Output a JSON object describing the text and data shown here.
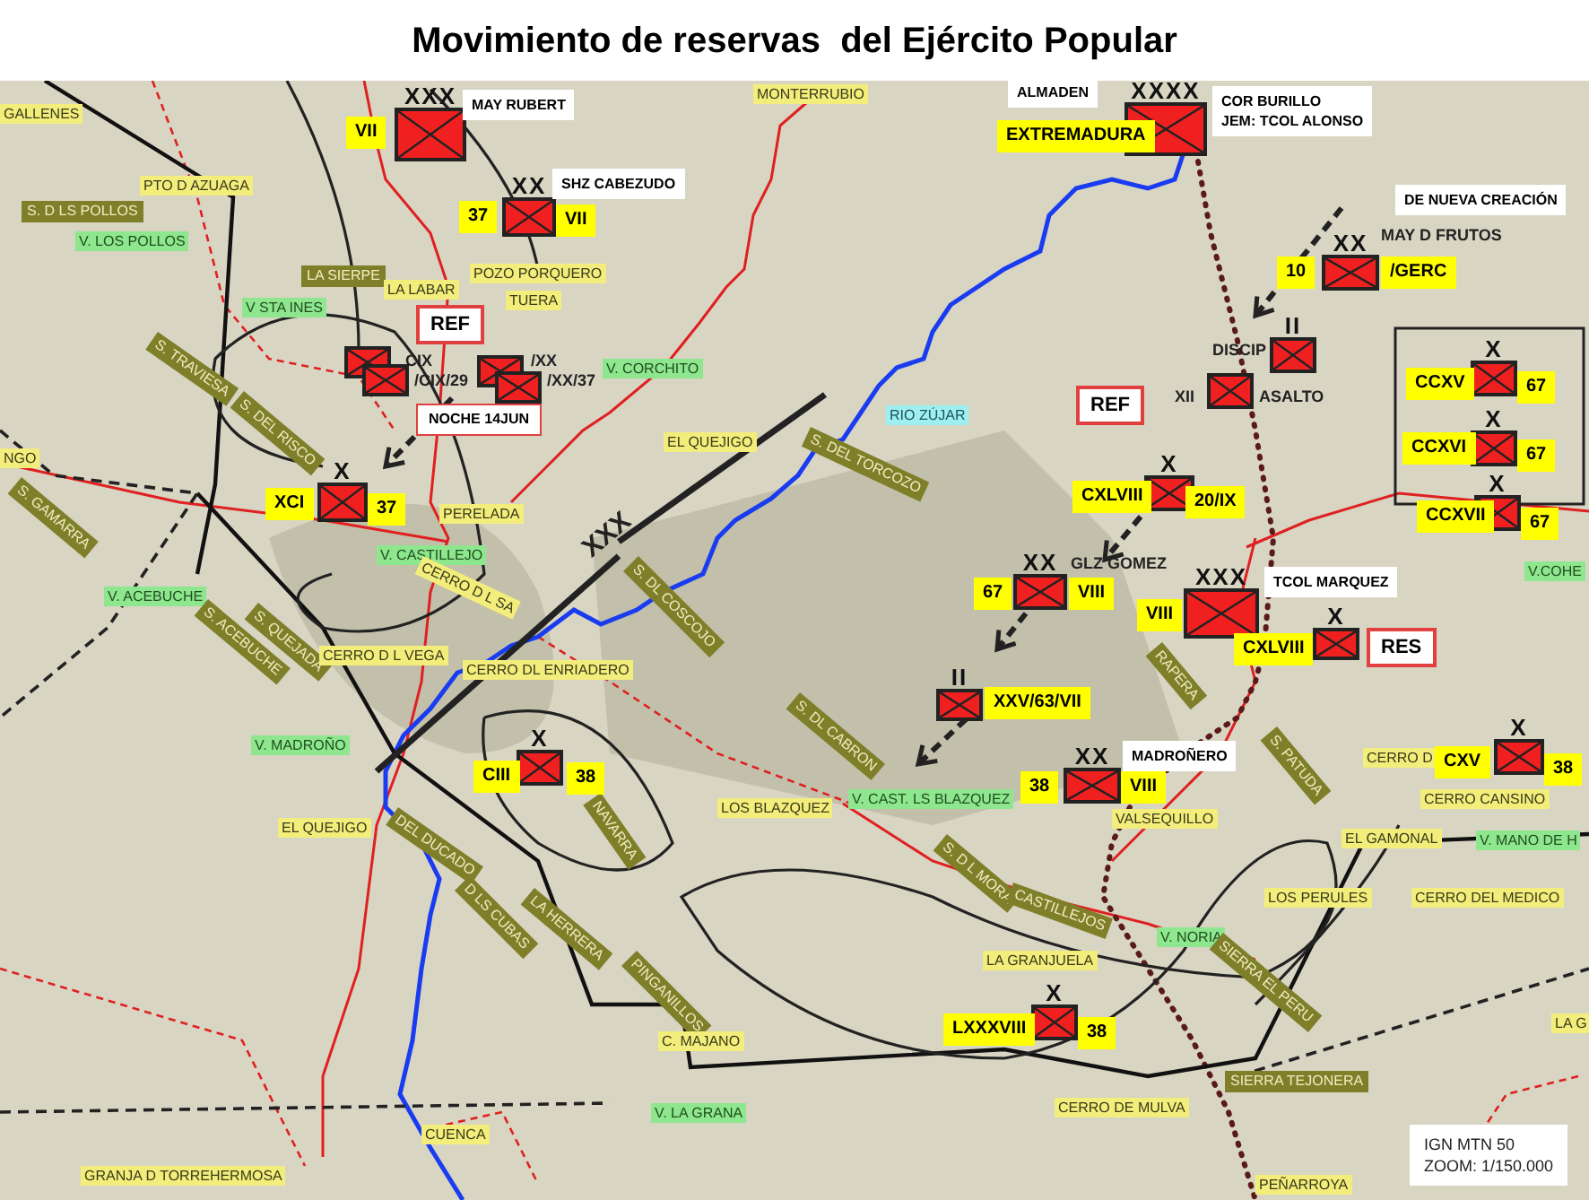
{
  "title": "Movimiento de reservas  del Ejército Popular",
  "units": [
    {
      "kind": "infantry",
      "echelon": "XXX"
    },
    {
      "kind": "infantry",
      "echelon": "XX"
    },
    {
      "kind": "infantry"
    },
    {
      "kind": "infantry"
    },
    {
      "kind": "infantry"
    },
    {
      "kind": "infantry"
    },
    {
      "kind": "infantry",
      "echelon": "X"
    },
    {
      "kind": "infantry",
      "echelon": "XXXX"
    },
    {
      "kind": "infantry",
      "echelon": "XX"
    },
    {
      "kind": "infantry",
      "echelon": "II"
    },
    {
      "kind": "infantry"
    },
    {
      "kind": "infantry",
      "echelon": "X"
    },
    {
      "kind": "infantry",
      "echelon": "X"
    },
    {
      "kind": "infantry",
      "echelon": "X"
    },
    {
      "kind": "infantry",
      "echelon": "X"
    },
    {
      "kind": "infantry",
      "echelon": "XX"
    },
    {
      "kind": "infantry",
      "echelon": "XXX"
    },
    {
      "kind": "infantry",
      "echelon": "X"
    },
    {
      "kind": "infantry",
      "echelon": "II"
    },
    {
      "kind": "infantry",
      "echelon": "XX"
    },
    {
      "kind": "infantry",
      "echelon": "X"
    },
    {
      "kind": "infantry",
      "echelon": "X"
    },
    {
      "kind": "infantry",
      "echelon": "X"
    }
  ],
  "callouts": [
    {
      "text": "MAY RUBERT",
      "kind": "note"
    },
    {
      "text": "VII",
      "kind": "tag"
    },
    {
      "text": "SHZ CABEZUDO",
      "kind": "note"
    },
    {
      "text": "37",
      "kind": "tag"
    },
    {
      "text": "VII",
      "kind": "tag"
    },
    {
      "text": "REF",
      "kind": "marker"
    },
    {
      "text": "CIX",
      "kind": "plain"
    },
    {
      "text": "/CIX/29",
      "kind": "plain"
    },
    {
      "text": "/XX",
      "kind": "plain"
    },
    {
      "text": "/XX/37",
      "kind": "plain"
    },
    {
      "text": "NOCHE 14JUN",
      "kind": "alert"
    },
    {
      "text": "XCI",
      "kind": "tag"
    },
    {
      "text": "37",
      "kind": "tag"
    },
    {
      "text": "XXX",
      "kind": "boundary"
    },
    {
      "text": "ALMADEN",
      "kind": "note"
    },
    {
      "text": "EXTREMADURA",
      "kind": "tag"
    },
    {
      "text": "COR BURILLO\nJEM: TCOL ALONSO",
      "kind": "note"
    },
    {
      "text": "DE NUEVA CREACIÓN",
      "kind": "note"
    },
    {
      "text": "MAY D FRUTOS",
      "kind": "plain"
    },
    {
      "text": "10",
      "kind": "tag"
    },
    {
      "text": "/GERC",
      "kind": "tag"
    },
    {
      "text": "DISCIP",
      "kind": "plain"
    },
    {
      "text": "XII",
      "kind": "plain"
    },
    {
      "text": "ASALTO",
      "kind": "plain"
    },
    {
      "text": "REF",
      "kind": "marker"
    },
    {
      "text": "CXLVIII",
      "kind": "tag"
    },
    {
      "text": "20/IX",
      "kind": "tag"
    },
    {
      "text": "CCXV",
      "kind": "tag"
    },
    {
      "text": "67",
      "kind": "tag"
    },
    {
      "text": "CCXVI",
      "kind": "tag"
    },
    {
      "text": "67",
      "kind": "tag"
    },
    {
      "text": "CCXVII",
      "kind": "tag"
    },
    {
      "text": "67",
      "kind": "tag"
    },
    {
      "text": "GLZ GOMEZ",
      "kind": "plain"
    },
    {
      "text": "67",
      "kind": "tag"
    },
    {
      "text": "VIII",
      "kind": "tag"
    },
    {
      "text": "TCOL MARQUEZ",
      "kind": "note"
    },
    {
      "text": "VIII",
      "kind": "tag"
    },
    {
      "text": "CXLVIII",
      "kind": "tag"
    },
    {
      "text": "RES",
      "kind": "marker"
    },
    {
      "text": "XXV/63/VII",
      "kind": "tag"
    },
    {
      "text": "MADROÑERO",
      "kind": "note"
    },
    {
      "text": "38",
      "kind": "tag"
    },
    {
      "text": "VIII",
      "kind": "tag"
    },
    {
      "text": "CIII",
      "kind": "tag"
    },
    {
      "text": "38",
      "kind": "tag"
    },
    {
      "text": "CXV",
      "kind": "tag"
    },
    {
      "text": "38",
      "kind": "tag"
    },
    {
      "text": "LXXXVIII",
      "kind": "tag"
    },
    {
      "text": "38",
      "kind": "tag"
    },
    {
      "text": "IGN MTN 50\nZOOM: 1/150.000",
      "kind": "source"
    }
  ],
  "place_labels": [
    {
      "text": "GALLENES",
      "kind": "town"
    },
    {
      "text": "PTO D AZUAGA",
      "kind": "town"
    },
    {
      "text": "S. D LS POLLOS",
      "kind": "range"
    },
    {
      "text": "V. LOS POLLOS",
      "kind": "vertex"
    },
    {
      "text": "LA SIERPE",
      "kind": "range"
    },
    {
      "text": "LA LABAR",
      "kind": "town"
    },
    {
      "text": "POZO PORQUERO",
      "kind": "town"
    },
    {
      "text": "TUERA",
      "kind": "town"
    },
    {
      "text": "V STA INES",
      "kind": "vertex"
    },
    {
      "text": "S. TRAVIESA",
      "kind": "range"
    },
    {
      "text": "S. DEL RISCO",
      "kind": "range"
    },
    {
      "text": "NGO",
      "kind": "town"
    },
    {
      "text": "S. GAMARRA",
      "kind": "range"
    },
    {
      "text": "V. CORCHITO",
      "kind": "vertex"
    },
    {
      "text": "EL QUEJIGO",
      "kind": "town"
    },
    {
      "text": "MONTERRUBIO",
      "kind": "town"
    },
    {
      "text": "RIO ZÚJAR",
      "kind": "river"
    },
    {
      "text": "S. DEL TORCOZO",
      "kind": "range"
    },
    {
      "text": "PERELADA",
      "kind": "town"
    },
    {
      "text": "V. CASTILLEJO",
      "kind": "vertex"
    },
    {
      "text": "CERRO D L SA",
      "kind": "town"
    },
    {
      "text": "V. ACEBUCHE",
      "kind": "vertex"
    },
    {
      "text": "S. ACEBUCHE",
      "kind": "range"
    },
    {
      "text": "S. DL COSCOJO",
      "kind": "range"
    },
    {
      "text": "S. QUEJADA",
      "kind": "range"
    },
    {
      "text": "CERRO D L VEGA",
      "kind": "town"
    },
    {
      "text": "CERRO DL ENRIADERO",
      "kind": "town"
    },
    {
      "text": "RAPERA",
      "kind": "range"
    },
    {
      "text": "S. PATUDA",
      "kind": "range"
    },
    {
      "text": "S. DL CABRON",
      "kind": "range"
    },
    {
      "text": "V. MADROÑO",
      "kind": "vertex"
    },
    {
      "text": "CERRO D",
      "kind": "town"
    },
    {
      "text": "CERRO CANSINO",
      "kind": "town"
    },
    {
      "text": "NAVARRA",
      "kind": "range"
    },
    {
      "text": "DEL DUCADO",
      "kind": "range"
    },
    {
      "text": "LOS BLAZQUEZ",
      "kind": "town"
    },
    {
      "text": "V. CAST. LS BLAZQUEZ",
      "kind": "vertex"
    },
    {
      "text": "EL QUEJIGO",
      "kind": "town"
    },
    {
      "text": "VALSEQUILLO",
      "kind": "town"
    },
    {
      "text": "EL GAMONAL",
      "kind": "town"
    },
    {
      "text": "V. MANO DE H",
      "kind": "vertex"
    },
    {
      "text": "S. D L MORA",
      "kind": "range"
    },
    {
      "text": "D LS CUBAS",
      "kind": "range"
    },
    {
      "text": "LA HERRERA",
      "kind": "range"
    },
    {
      "text": "CASTILLEJOS",
      "kind": "range"
    },
    {
      "text": "LOS PERULES",
      "kind": "town"
    },
    {
      "text": "CERRO DEL MEDICO",
      "kind": "town"
    },
    {
      "text": "V. NORIA",
      "kind": "vertex"
    },
    {
      "text": "SIERRA EL PERU",
      "kind": "range"
    },
    {
      "text": "PINGANILLOS",
      "kind": "range"
    },
    {
      "text": "LA GRANJUELA",
      "kind": "town"
    },
    {
      "text": "LA G",
      "kind": "town"
    },
    {
      "text": "C. MAJANO",
      "kind": "town"
    },
    {
      "text": "SIERRA TEJONERA",
      "kind": "range"
    },
    {
      "text": "V. LA GRANA",
      "kind": "vertex"
    },
    {
      "text": "CUENCA",
      "kind": "town"
    },
    {
      "text": "CERRO DE MULVA",
      "kind": "town"
    },
    {
      "text": "GRANJA D TORREHERMOSA",
      "kind": "town"
    },
    {
      "text": "PEÑARROYA",
      "kind": "town"
    },
    {
      "text": "V.COHE",
      "kind": "vertex"
    }
  ]
}
